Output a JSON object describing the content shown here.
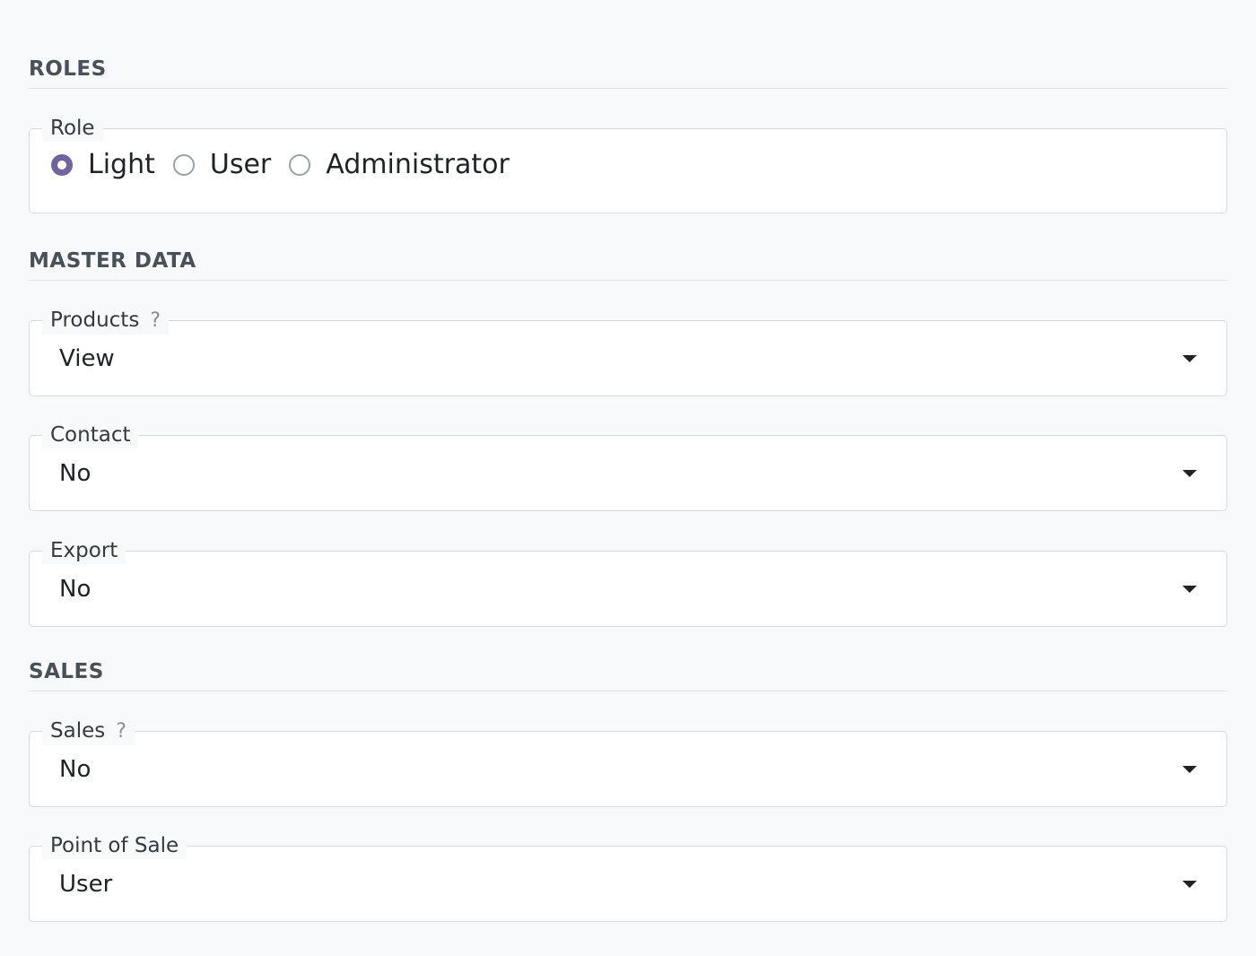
{
  "roles": {
    "heading": "ROLES",
    "role_field": {
      "legend": "Role",
      "options": [
        {
          "label": "Light",
          "checked": true
        },
        {
          "label": "User",
          "checked": false
        },
        {
          "label": "Administrator",
          "checked": false
        }
      ],
      "selected": "Light"
    }
  },
  "master_data": {
    "heading": "MASTER DATA",
    "products": {
      "legend": "Products",
      "help": "?",
      "value": "View"
    },
    "contact": {
      "legend": "Contact",
      "value": "No"
    },
    "export": {
      "legend": "Export",
      "value": "No"
    }
  },
  "sales": {
    "heading": "SALES",
    "sales": {
      "legend": "Sales",
      "help": "?",
      "value": "No"
    },
    "point_of_sale": {
      "legend": "Point of Sale",
      "value": "User"
    }
  },
  "colors": {
    "accent": "#71639e",
    "background": "#f8f9fa",
    "heading_text": "#495057"
  },
  "icons": {
    "help": "question-mark-icon",
    "dropdown": "caret-down-icon"
  }
}
